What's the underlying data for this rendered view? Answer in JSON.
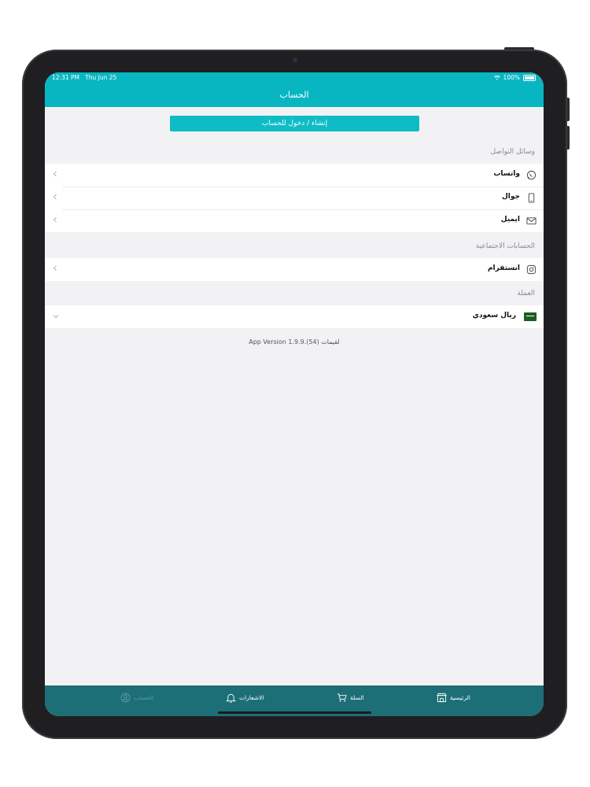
{
  "status_bar": {
    "time": "12:31 PM",
    "date": "Thu Jun 25",
    "battery": "100%"
  },
  "header": {
    "title": "الحساب"
  },
  "login_button": "إنشاء / دخول للحساب",
  "contact": {
    "title": "وسائل التواصل",
    "items": [
      {
        "label": "واتساب",
        "icon": "whatsapp-icon"
      },
      {
        "label": "جوال",
        "icon": "mobile-phone-icon"
      },
      {
        "label": "ايميل",
        "icon": "email-icon"
      }
    ]
  },
  "social": {
    "title": "الحسابات الاجتماعية",
    "items": [
      {
        "label": "انستقرام",
        "icon": "instagram-icon"
      }
    ]
  },
  "currency": {
    "title": "العملة",
    "selected": "ريال سعودي"
  },
  "version": "App Version 1.9.9.(54) لقيمات",
  "tabs": [
    {
      "label": "الرئيسية",
      "icon": "store-icon"
    },
    {
      "label": "السلة",
      "icon": "cart-icon"
    },
    {
      "label": "الاشعارات",
      "icon": "bell-icon"
    },
    {
      "label": "الحساب",
      "icon": "account-icon"
    }
  ],
  "colors": {
    "header": "#08b6c2",
    "tabbar": "#1d6f77",
    "button": "#0ebcc6"
  }
}
